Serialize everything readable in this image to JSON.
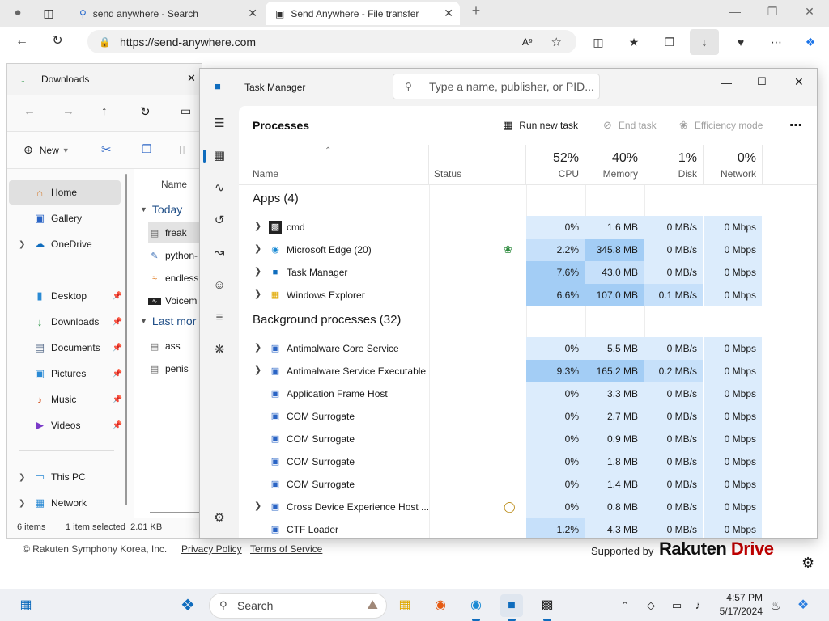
{
  "browser": {
    "tabs": [
      {
        "label": "send anywhere - Search",
        "icon": "search-icon"
      },
      {
        "label": "Send Anywhere - File transfer",
        "icon": "send-anywhere-icon",
        "active": true
      }
    ],
    "url": "https://send-anywhere.com"
  },
  "page": {
    "copyright": "© Rakuten Symphony Korea, Inc.",
    "privacy": "Privacy Policy",
    "terms": "Terms of Service",
    "supported_by": "Supported by",
    "brand_a": "Rakuten ",
    "brand_b": "Drive"
  },
  "explorer": {
    "title": "Downloads",
    "new_label": "New",
    "column_name": "Name",
    "sidebar": [
      {
        "label": "Home",
        "icon": "home-icon",
        "selected": true
      },
      {
        "label": "Gallery",
        "icon": "gallery-icon"
      },
      {
        "label": "OneDrive",
        "icon": "cloud-icon"
      },
      {
        "label": "Desktop",
        "icon": "desktop-icon"
      },
      {
        "label": "Downloads",
        "icon": "download-icon"
      },
      {
        "label": "Documents",
        "icon": "documents-icon"
      },
      {
        "label": "Pictures",
        "icon": "pictures-icon"
      },
      {
        "label": "Music",
        "icon": "music-icon"
      },
      {
        "label": "Videos",
        "icon": "videos-icon"
      },
      {
        "label": "This PC",
        "icon": "computer-icon"
      },
      {
        "label": "Network",
        "icon": "network-icon"
      }
    ],
    "groups": {
      "today": "Today",
      "last": "Last mor"
    },
    "files_today": [
      "freak",
      "python-",
      "endless",
      "Voicem"
    ],
    "files_last": [
      "ass",
      "penis"
    ],
    "status_items": "6 items",
    "status_selected": "1 item selected  2.01 KB"
  },
  "taskmgr": {
    "title": "Task Manager",
    "search_placeholder": "Type a name, publisher, or PID...",
    "heading": "Processes",
    "run_new_task": "Run new task",
    "end_task": "End task",
    "efficiency_mode": "Efficiency mode",
    "columns": {
      "name": "Name",
      "status": "Status",
      "cpu_pct": "52%",
      "cpu": "CPU",
      "mem_pct": "40%",
      "mem": "Memory",
      "disk_pct": "1%",
      "disk": "Disk",
      "net_pct": "0%",
      "net": "Network"
    },
    "apps_group": "Apps (4)",
    "bg_group": "Background processes (32)",
    "apps": [
      {
        "name": "cmd",
        "cpu": "0%",
        "mem": "1.6 MB",
        "disk": "0 MB/s",
        "net": "0 Mbps",
        "expand": true,
        "icon": "cmd-icon"
      },
      {
        "name": "Microsoft Edge (20)",
        "cpu": "2.2%",
        "mem": "345.8 MB",
        "disk": "0 MB/s",
        "net": "0 Mbps",
        "expand": true,
        "icon": "edge-icon",
        "status": "efficiency-leaf-icon"
      },
      {
        "name": "Task Manager",
        "cpu": "7.6%",
        "mem": "43.0 MB",
        "disk": "0 MB/s",
        "net": "0 Mbps",
        "expand": true,
        "icon": "task-manager-icon"
      },
      {
        "name": "Windows Explorer",
        "cpu": "6.6%",
        "mem": "107.0 MB",
        "disk": "0.1 MB/s",
        "net": "0 Mbps",
        "expand": true,
        "icon": "folder-icon"
      }
    ],
    "background": [
      {
        "name": "Antimalware Core Service",
        "cpu": "0%",
        "mem": "5.5 MB",
        "disk": "0 MB/s",
        "net": "0 Mbps",
        "expand": true
      },
      {
        "name": "Antimalware Service Executable",
        "cpu": "9.3%",
        "mem": "165.2 MB",
        "disk": "0.2 MB/s",
        "net": "0 Mbps",
        "expand": true
      },
      {
        "name": "Application Frame Host",
        "cpu": "0%",
        "mem": "3.3 MB",
        "disk": "0 MB/s",
        "net": "0 Mbps"
      },
      {
        "name": "COM Surrogate",
        "cpu": "0%",
        "mem": "2.7 MB",
        "disk": "0 MB/s",
        "net": "0 Mbps"
      },
      {
        "name": "COM Surrogate",
        "cpu": "0%",
        "mem": "0.9 MB",
        "disk": "0 MB/s",
        "net": "0 Mbps"
      },
      {
        "name": "COM Surrogate",
        "cpu": "0%",
        "mem": "1.8 MB",
        "disk": "0 MB/s",
        "net": "0 Mbps"
      },
      {
        "name": "COM Surrogate",
        "cpu": "0%",
        "mem": "1.4 MB",
        "disk": "0 MB/s",
        "net": "0 Mbps"
      },
      {
        "name": "Cross Device Experience Host ...",
        "cpu": "0%",
        "mem": "0.8 MB",
        "disk": "0 MB/s",
        "net": "0 Mbps",
        "expand": true,
        "status": "paused-icon"
      },
      {
        "name": "CTF Loader",
        "cpu": "1.2%",
        "mem": "4.3 MB",
        "disk": "0 MB/s",
        "net": "0 Mbps"
      }
    ]
  },
  "taskbar": {
    "search": "Search",
    "time": "4:57 PM",
    "date": "5/17/2024"
  }
}
